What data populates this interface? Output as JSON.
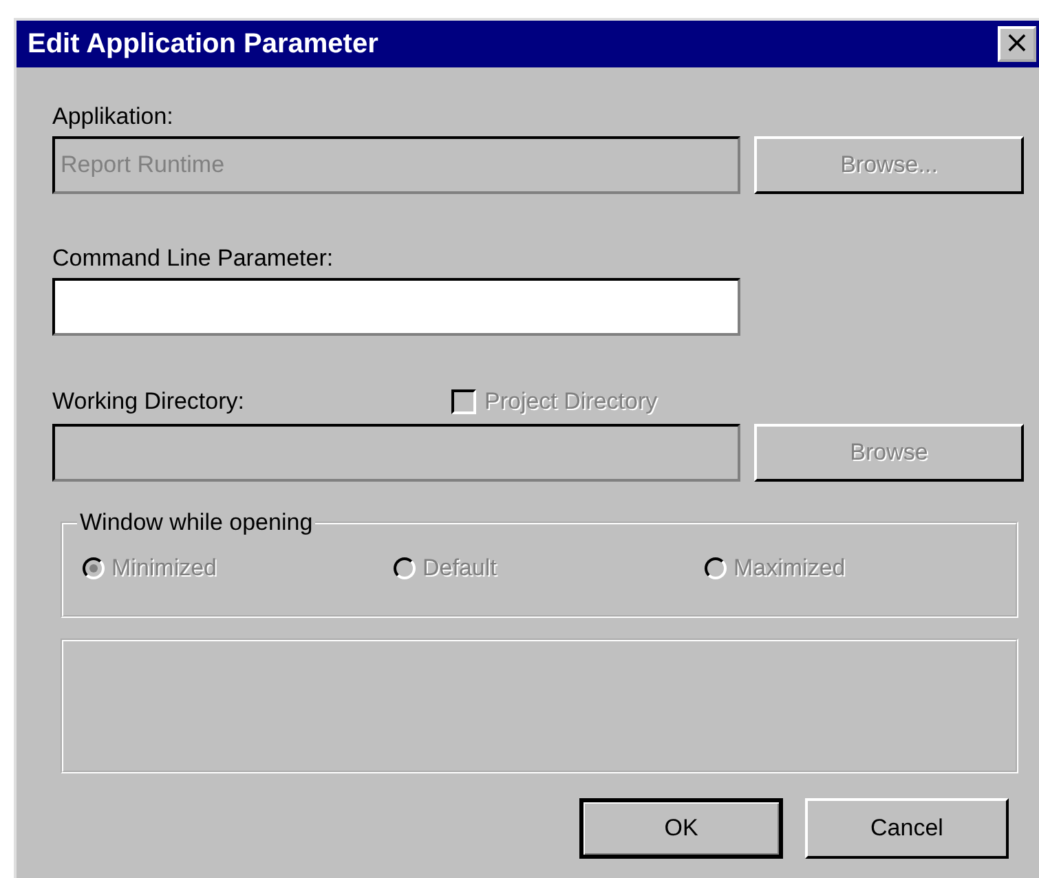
{
  "window": {
    "title": "Edit Application Parameter",
    "close": "×"
  },
  "application": {
    "label": "Applikation:",
    "value": "Report Runtime",
    "disabled": true,
    "button": {
      "label": "Browse...",
      "disabled": true
    }
  },
  "command_line": {
    "label": "Command Line Parameter:",
    "disabled": false
  },
  "working_directory": {
    "label": "Working Directory:",
    "checkbox": {
      "label": "Project Directory",
      "checked": false,
      "disabled": true
    },
    "disabled": true,
    "button": {
      "label": "Browse",
      "disabled": true
    }
  },
  "window_group": {
    "title": "Window while opening",
    "options": [
      {
        "label": "Minimized",
        "selected": true,
        "disabled": true
      },
      {
        "label": "Default",
        "selected": false,
        "disabled": true
      },
      {
        "label": "Maximized",
        "selected": false,
        "disabled": true
      }
    ]
  },
  "buttons": [
    {
      "label": "OK",
      "default": true
    },
    {
      "label": "Cancel",
      "default": false
    }
  ]
}
